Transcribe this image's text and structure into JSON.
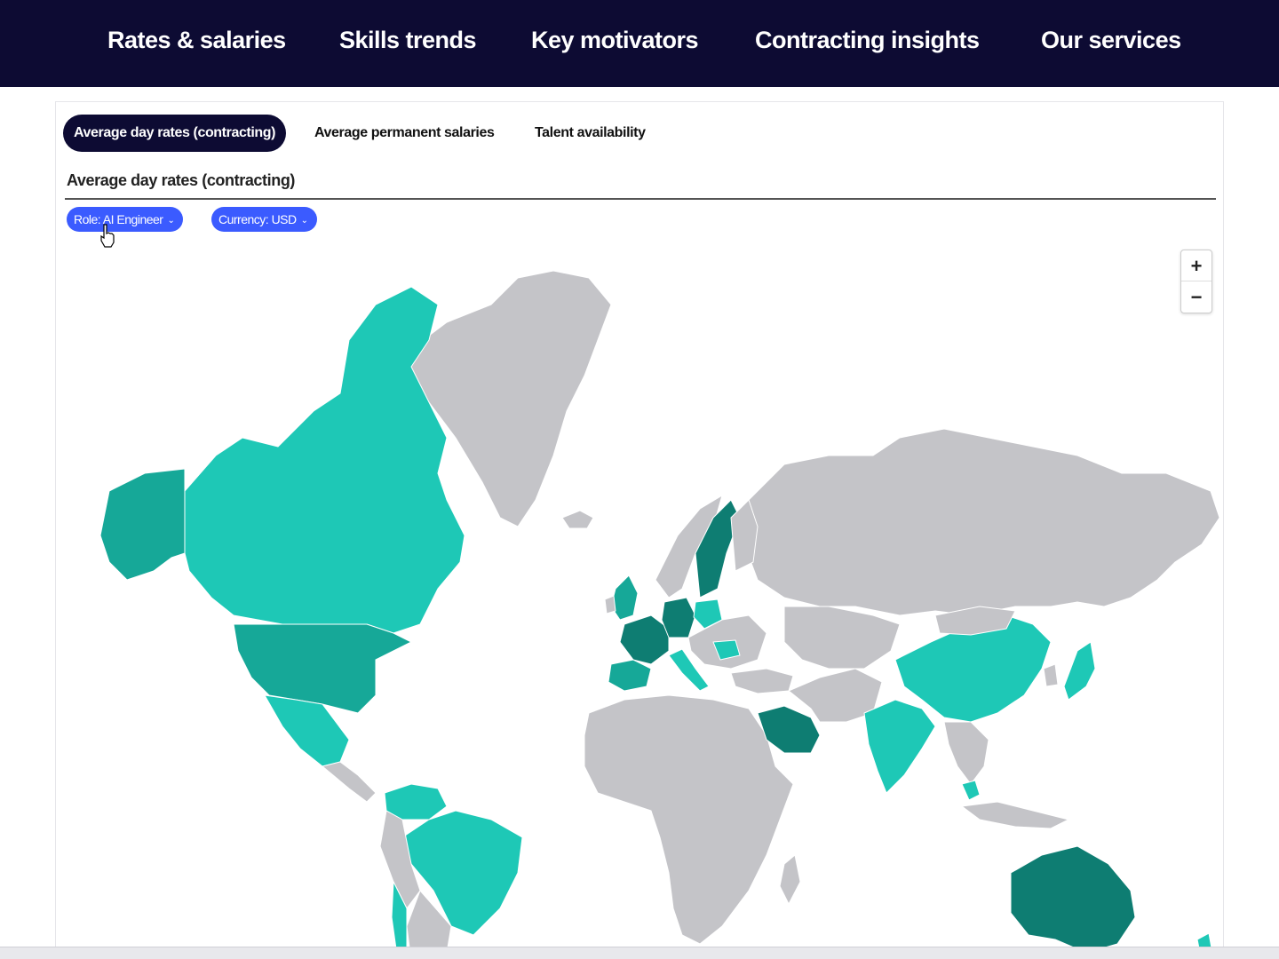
{
  "nav": {
    "items": [
      "Rates & salaries",
      "Skills trends",
      "Key motivators",
      "Contracting insights",
      "Our services"
    ]
  },
  "tabs": {
    "items": [
      "Average day rates (contracting)",
      "Average permanent salaries",
      "Talent availability"
    ],
    "active": "Average day rates (contracting)"
  },
  "section": {
    "title": "Average day rates (contracting)"
  },
  "filters": {
    "role": "Role: AI Engineer",
    "currency": "Currency: USD"
  },
  "zoom": {
    "in_label": "+",
    "out_label": "−"
  },
  "map": {
    "type": "choropleth-world",
    "colors": {
      "no_data": "#c4c4c8",
      "tier_light": "#1ec8b6",
      "tier_mid": "#16a898",
      "tier_dark": "#0e7d72",
      "border": "#ffffff"
    },
    "countries": [
      {
        "name": "Canada",
        "tier": "light"
      },
      {
        "name": "United States",
        "tier": "mid"
      },
      {
        "name": "Alaska",
        "tier": "mid"
      },
      {
        "name": "Mexico",
        "tier": "light"
      },
      {
        "name": "Brazil",
        "tier": "light"
      },
      {
        "name": "Colombia",
        "tier": "light"
      },
      {
        "name": "Chile",
        "tier": "light"
      },
      {
        "name": "United Kingdom",
        "tier": "mid"
      },
      {
        "name": "France",
        "tier": "dark"
      },
      {
        "name": "Germany",
        "tier": "dark"
      },
      {
        "name": "Sweden",
        "tier": "dark"
      },
      {
        "name": "Spain",
        "tier": "mid"
      },
      {
        "name": "Italy",
        "tier": "light"
      },
      {
        "name": "Poland",
        "tier": "light"
      },
      {
        "name": "Romania",
        "tier": "light"
      },
      {
        "name": "Saudi Arabia",
        "tier": "dark"
      },
      {
        "name": "India",
        "tier": "light"
      },
      {
        "name": "China",
        "tier": "light"
      },
      {
        "name": "Japan",
        "tier": "light"
      },
      {
        "name": "Malaysia",
        "tier": "light"
      },
      {
        "name": "Australia",
        "tier": "dark"
      },
      {
        "name": "New Zealand",
        "tier": "light"
      }
    ]
  }
}
